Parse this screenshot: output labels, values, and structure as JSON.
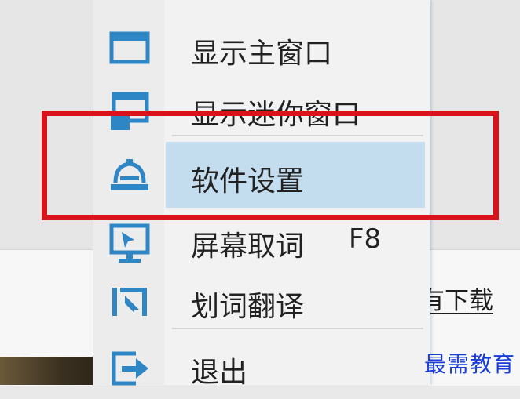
{
  "menu": {
    "items": [
      {
        "label": "显示主窗口",
        "icon": "main-window-icon"
      },
      {
        "label": "显示迷你窗口",
        "icon": "mini-window-icon"
      },
      {
        "label": "软件设置",
        "icon": "settings-icon",
        "highlighted": true
      },
      {
        "label": "屏幕取词",
        "shortcut": "F8",
        "icon": "screen-capture-icon"
      },
      {
        "label": "划词翻译",
        "icon": "select-translate-icon"
      },
      {
        "label": "退出",
        "icon": "exit-icon"
      }
    ]
  },
  "background": {
    "text": "有下载"
  },
  "watermark": "最需教育",
  "colors": {
    "icon": "#2f86c4",
    "highlight": "#c3dcee",
    "annotation": "#d9121b",
    "watermark": "#1a3dd8"
  }
}
